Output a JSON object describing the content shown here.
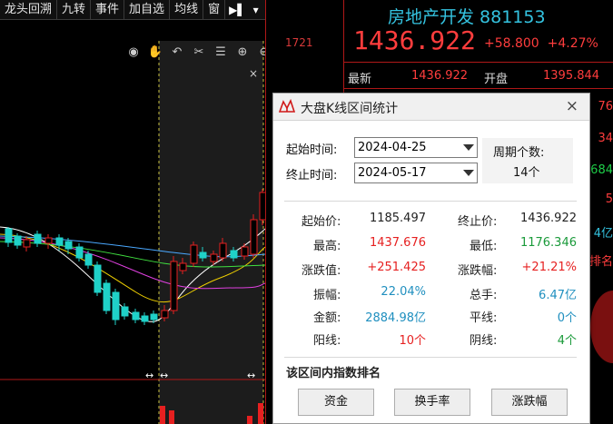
{
  "toolbar": {
    "items": [
      "龙头回溯",
      "九转",
      "事件",
      "加自选",
      "均线",
      "窗"
    ],
    "arrow_label": "▶▌",
    "dropdown_label": "▾"
  },
  "chart": {
    "price_label": "1721",
    "close_glyph": "×",
    "drag_glyph": "↔",
    "icons": [
      "eye-icon",
      "hand-icon",
      "undo-icon",
      "scissors-icon",
      "sliders-icon",
      "zoom-in-icon",
      "zoom-out-icon"
    ]
  },
  "quote": {
    "name": "房地产开发",
    "code": "881153",
    "price": "1436.922",
    "change": "+58.800",
    "change_pct": "+4.27%",
    "latest_label": "最新",
    "latest_value": "1436.922",
    "open_label": "开盘",
    "open_value": "1395.844",
    "side_fragments": [
      "76",
      "34",
      "684",
      "5",
      "4亿",
      "排名",
      "%"
    ]
  },
  "dialog": {
    "title": "大盘K线区间统计",
    "close_glyph": "×",
    "start_label": "起始时间:",
    "start_value": "2024-04-25",
    "end_label": "终止时间:",
    "end_value": "2024-05-17",
    "period_label": "周期个数:",
    "period_value": "14个",
    "stats": {
      "start_price_label": "起始价:",
      "start_price": "1185.497",
      "end_price_label": "终止价:",
      "end_price": "1436.922",
      "high_label": "最高:",
      "high": "1437.676",
      "low_label": "最低:",
      "low": "1176.346",
      "chg_value_label": "涨跌值:",
      "chg_value": "+251.425",
      "chg_pct_label": "涨跌幅:",
      "chg_pct": "+21.21%",
      "amplitude_label": "振幅:",
      "amplitude": "22.04%",
      "turnover_label": "总手:",
      "turnover": "6.47亿",
      "amount_label": "金额:",
      "amount": "2884.98亿",
      "flat_label": "平线:",
      "flat": "0个",
      "up_label": "阳线:",
      "up": "10个",
      "down_label": "阴线:",
      "down": "4个"
    },
    "section_title": "该区间内指数排名",
    "buttons": [
      "资金",
      "换手率",
      "涨跌幅"
    ]
  },
  "colors": {
    "up_red": "#e62020",
    "down_green": "#1a9a3a",
    "accent_cyan": "#34c3e0",
    "selection_line": "#c8c040"
  }
}
